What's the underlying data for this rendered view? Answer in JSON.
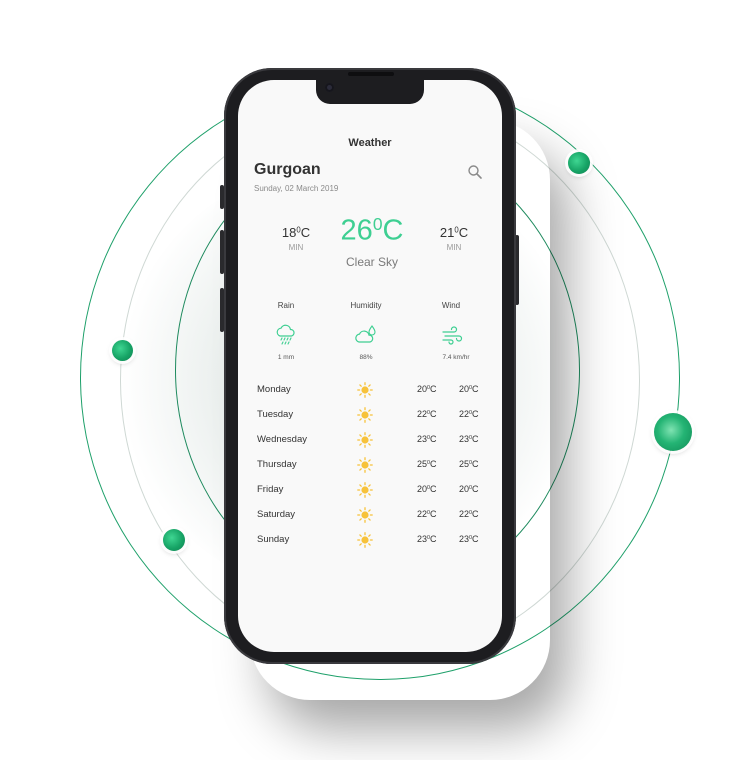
{
  "app": {
    "title": "Weather"
  },
  "location": {
    "city": "Gurgoan",
    "date": "Sunday, 02 March 2019"
  },
  "current": {
    "min_temp": "18",
    "min_label": "MIN",
    "temp": "26",
    "condition": "Clear Sky",
    "max_temp": "21",
    "max_label": "MIN",
    "unit_degree": "0",
    "unit_c": "C"
  },
  "stats": [
    {
      "label": "Rain",
      "value": "1 mm",
      "icon": "rain-cloud-icon"
    },
    {
      "label": "Humidity",
      "value": "88%",
      "icon": "humidity-cloud-icon"
    },
    {
      "label": "Wind",
      "value": "7.4 km/hr",
      "icon": "wind-icon"
    }
  ],
  "forecast": [
    {
      "day": "Monday",
      "t1": "20",
      "t2": "20"
    },
    {
      "day": "Tuesday",
      "t1": "22",
      "t2": "22"
    },
    {
      "day": "Wednesday",
      "t1": "23",
      "t2": "23"
    },
    {
      "day": "Thursday",
      "t1": "25",
      "t2": "25"
    },
    {
      "day": "Friday",
      "t1": "20",
      "t2": "20"
    },
    {
      "day": "Saturday",
      "t1": "22",
      "t2": "22"
    },
    {
      "day": "Sunday",
      "t1": "23",
      "t2": "23"
    }
  ],
  "colors": {
    "accent": "#3ecf92",
    "sun": "#f7c23a",
    "orbit": "#1ea06a"
  }
}
